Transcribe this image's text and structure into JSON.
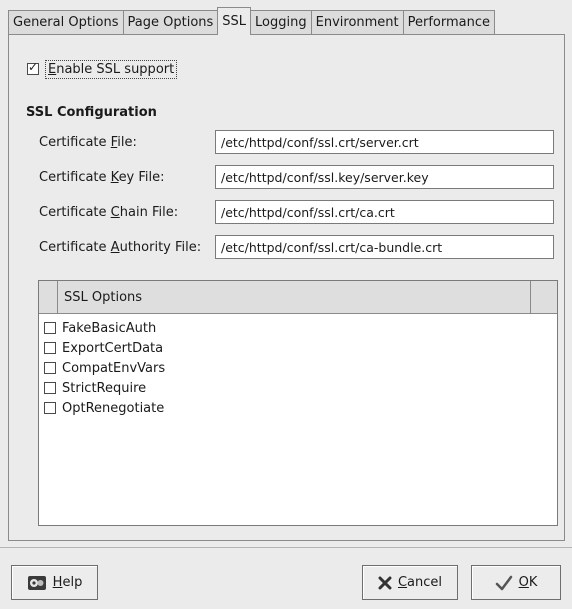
{
  "tabs": [
    {
      "label": "General Options",
      "active": false
    },
    {
      "label": "Page Options",
      "active": false
    },
    {
      "label": "SSL",
      "active": true
    },
    {
      "label": "Logging",
      "active": false
    },
    {
      "label": "Environment",
      "active": false
    },
    {
      "label": "Performance",
      "active": false
    }
  ],
  "ssl": {
    "enable_label_mnemonic": "E",
    "enable_label_rest": "nable SSL support",
    "enable_checked": true,
    "section_title": "SSL Configuration",
    "fields": [
      {
        "label_pre": "Certificate ",
        "label_mn": "F",
        "label_post": "ile:",
        "value": "/etc/httpd/conf/ssl.crt/server.crt"
      },
      {
        "label_pre": "Certificate ",
        "label_mn": "K",
        "label_post": "ey File:",
        "value": "/etc/httpd/conf/ssl.key/server.key"
      },
      {
        "label_pre": "Certificate ",
        "label_mn": "C",
        "label_post": "hain File:",
        "value": "/etc/httpd/conf/ssl.crt/ca.crt"
      },
      {
        "label_pre": "Certificate ",
        "label_mn": "A",
        "label_post": "uthority File:",
        "value": "/etc/httpd/conf/ssl.crt/ca-bundle.crt"
      }
    ],
    "options_header": "SSL Options",
    "options": [
      {
        "label": "FakeBasicAuth",
        "checked": false
      },
      {
        "label": "ExportCertData",
        "checked": false
      },
      {
        "label": "CompatEnvVars",
        "checked": false
      },
      {
        "label": "StrictRequire",
        "checked": false
      },
      {
        "label": "OptRenegotiate",
        "checked": false
      }
    ]
  },
  "buttons": {
    "help_mn": "H",
    "help_rest": "elp",
    "cancel_mn": "C",
    "cancel_rest": "ancel",
    "ok_mn": "O",
    "ok_rest": "K"
  },
  "icons": {
    "help": "help-icon",
    "cancel": "cancel-x-icon",
    "ok": "ok-check-icon"
  }
}
